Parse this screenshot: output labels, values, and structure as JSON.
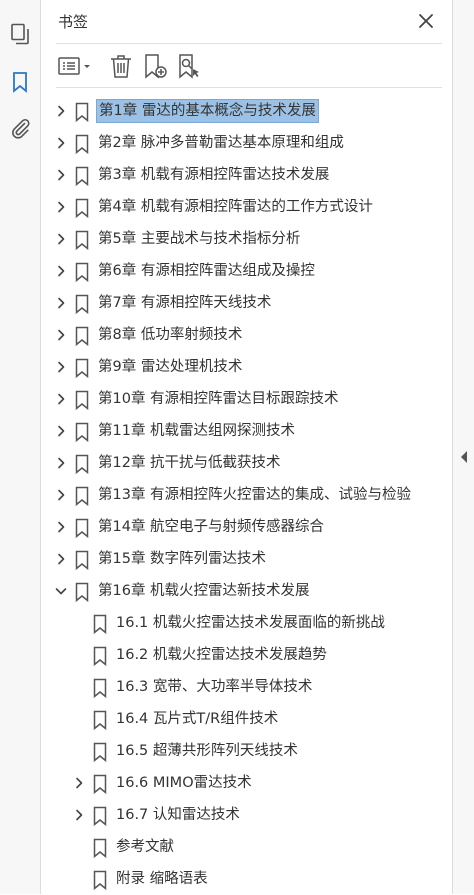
{
  "panel": {
    "title": "书签"
  },
  "colors": {
    "selection": "#9bc2e6",
    "icon": "#555555",
    "rail_active": "#2a78c8"
  },
  "toolbar": {
    "icons": [
      "options-menu-icon",
      "trash-icon",
      "new-bookmark-icon",
      "bookmark-from-selection-icon"
    ]
  },
  "bookmarks": [
    {
      "label": "第1章 雷达的基本概念与技术发展",
      "level": 0,
      "state": "collapsed",
      "selected": true
    },
    {
      "label": "第2章 脉冲多普勒雷达基本原理和组成",
      "level": 0,
      "state": "collapsed"
    },
    {
      "label": "第3章 机载有源相控阵雷达技术发展",
      "level": 0,
      "state": "collapsed"
    },
    {
      "label": "第4章 机载有源相控阵雷达的工作方式设计",
      "level": 0,
      "state": "collapsed"
    },
    {
      "label": "第5章 主要战术与技术指标分析",
      "level": 0,
      "state": "collapsed"
    },
    {
      "label": "第6章 有源相控阵雷达组成及操控",
      "level": 0,
      "state": "collapsed"
    },
    {
      "label": "第7章 有源相控阵天线技术",
      "level": 0,
      "state": "collapsed"
    },
    {
      "label": "第8章 低功率射频技术",
      "level": 0,
      "state": "collapsed"
    },
    {
      "label": "第9章 雷达处理机技术",
      "level": 0,
      "state": "collapsed"
    },
    {
      "label": "第10章 有源相控阵雷达目标跟踪技术",
      "level": 0,
      "state": "collapsed"
    },
    {
      "label": "第11章 机载雷达组网探测技术",
      "level": 0,
      "state": "collapsed"
    },
    {
      "label": "第12章 抗干扰与低截获技术",
      "level": 0,
      "state": "collapsed"
    },
    {
      "label": "第13章 有源相控阵火控雷达的集成、试验与检验",
      "level": 0,
      "state": "collapsed"
    },
    {
      "label": "第14章 航空电子与射频传感器综合",
      "level": 0,
      "state": "collapsed"
    },
    {
      "label": "第15章 数字阵列雷达技术",
      "level": 0,
      "state": "collapsed"
    },
    {
      "label": "第16章 机载火控雷达新技术发展",
      "level": 0,
      "state": "expanded"
    },
    {
      "label": "16.1 机载火控雷达技术发展面临的新挑战",
      "level": 1,
      "state": "leaf"
    },
    {
      "label": "16.2 机载火控雷达技术发展趋势",
      "level": 1,
      "state": "leaf"
    },
    {
      "label": "16.3 宽带、大功率半导体技术",
      "level": 1,
      "state": "leaf"
    },
    {
      "label": "16.4 瓦片式T/R组件技术",
      "level": 1,
      "state": "leaf"
    },
    {
      "label": "16.5 超薄共形阵列天线技术",
      "level": 1,
      "state": "leaf"
    },
    {
      "label": "16.6 MIMO雷达技术",
      "level": 1,
      "state": "collapsed"
    },
    {
      "label": "16.7 认知雷达技术",
      "level": 1,
      "state": "collapsed"
    },
    {
      "label": "参考文献",
      "level": 1,
      "state": "leaf"
    },
    {
      "label": "附录 缩略语表",
      "level": 1,
      "state": "leaf"
    }
  ]
}
